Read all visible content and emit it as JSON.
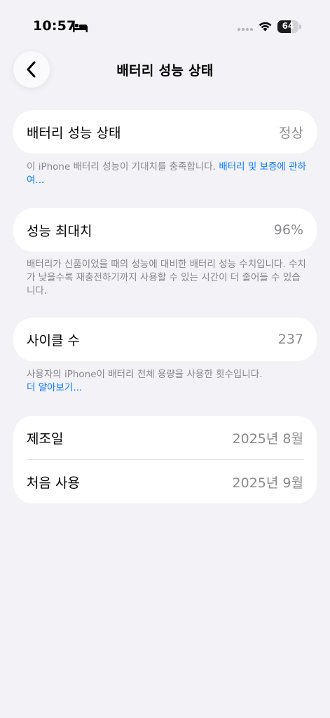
{
  "status_bar": {
    "time": "10:57",
    "battery_level": "64",
    "battery_fraction": 0.64
  },
  "nav": {
    "title": "배터리 성능 상태"
  },
  "battery_health": {
    "label": "배터리 성능 상태",
    "value": "정상",
    "note_text": "이 iPhone 배터리 성능이 기대치를 충족합니다. ",
    "note_link": "배터리 및 보증에 관하여..."
  },
  "max_capacity": {
    "label": "성능 최대치",
    "value": "96%",
    "note": "배터리가 신품이었을 때의 성능에 대비한 배터리 성능 수치입니다. 수치가 낮을수록 재충전하기까지 사용할 수 있는 시간이 더 줄어들 수 있습니다."
  },
  "cycle_count": {
    "label": "사이클 수",
    "value": "237",
    "note_text": "사용자의 iPhone이 배터리 전체 용량을 사용한 횟수입니다.",
    "note_link": "더 알아보기..."
  },
  "dates": {
    "manufacture_label": "제조일",
    "manufacture_value": "2025년 8월",
    "first_use_label": "처음 사용",
    "first_use_value": "2025년 9월"
  },
  "colors": {
    "background": "#f2f2f7",
    "card": "#ffffff",
    "link": "#0a7aff",
    "secondary_text": "#8a8a8e"
  }
}
